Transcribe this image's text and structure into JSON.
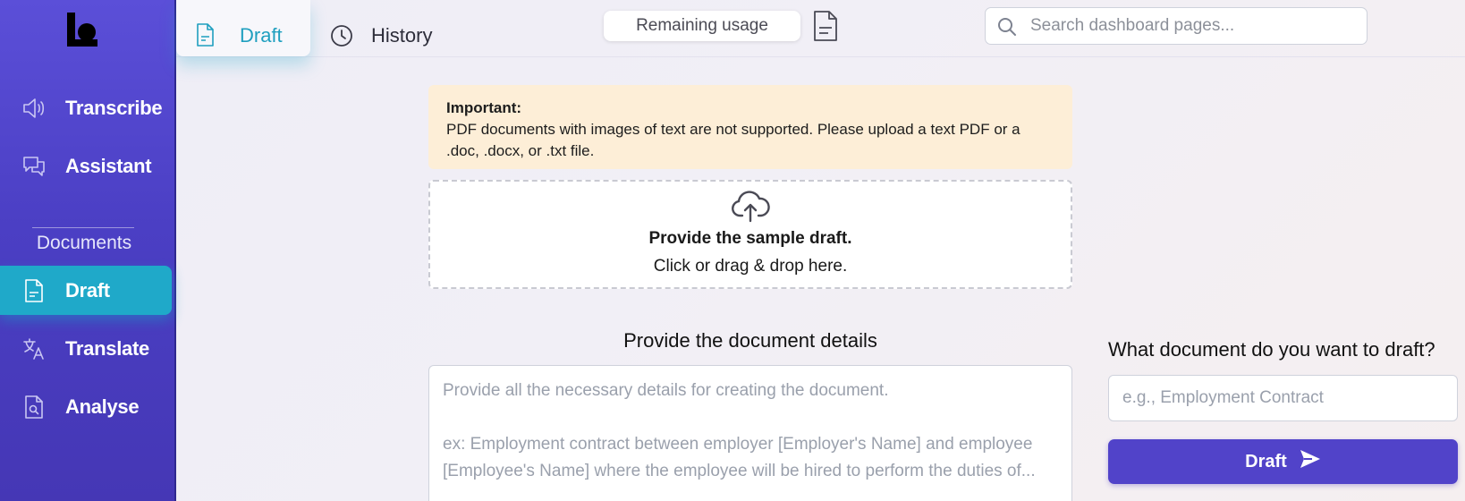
{
  "sidebar": {
    "items": [
      {
        "label": "Transcribe",
        "icon": "speaker-icon"
      },
      {
        "label": "Assistant",
        "icon": "chat-bubbles-icon"
      }
    ],
    "section_label": "Documents",
    "doc_items": [
      {
        "label": "Draft",
        "icon": "document-icon",
        "active": true
      },
      {
        "label": "Translate",
        "icon": "translate-icon"
      },
      {
        "label": "Analyse",
        "icon": "document-search-icon"
      }
    ],
    "accent_color": "#1fa9c9",
    "background_color": "#4f43cc"
  },
  "topbar": {
    "tabs": [
      {
        "label": "Draft",
        "icon": "document-icon",
        "active": true
      },
      {
        "label": "History",
        "icon": "clock-icon"
      }
    ],
    "usage_label": "Remaining usage",
    "search": {
      "placeholder": "Search dashboard pages..."
    }
  },
  "notice": {
    "title": "Important:",
    "body": "PDF documents with images of text are not supported. Please upload a text PDF or a .doc, .docx, or .txt file."
  },
  "upload": {
    "line1": "Provide the sample draft.",
    "line2": "Click or drag & drop here."
  },
  "details": {
    "title": "Provide the document details",
    "placeholder": "Provide all the necessary details for creating the document.\n\nex: Employment contract between employer [Employer's Name] and employee [Employee's Name] where the employee will be hired to perform the duties of..."
  },
  "draft_panel": {
    "title": "What document do you want to draft?",
    "input_placeholder": "e.g., Employment Contract",
    "button_label": "Draft",
    "button_color": "#5143c9"
  }
}
